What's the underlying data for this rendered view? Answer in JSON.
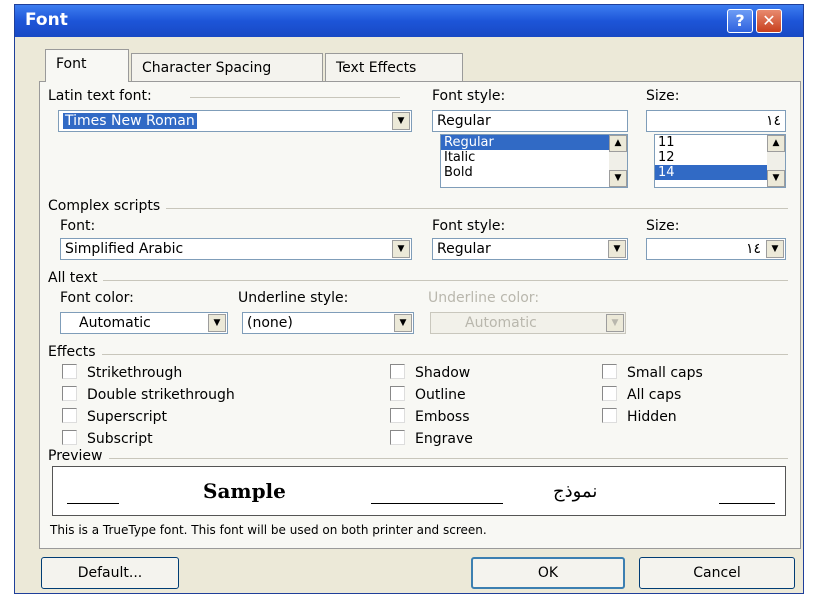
{
  "window": {
    "title": "Font",
    "help_glyph": "?",
    "close_glyph": "✕"
  },
  "tabs": [
    "Font",
    "Character Spacing",
    "Text Effects"
  ],
  "latin": {
    "font_label": "Latin text font:",
    "font_value": "Times New Roman",
    "style_label": "Font style:",
    "style_value": "Regular",
    "style_list": [
      "Regular",
      "Italic",
      "Bold"
    ],
    "size_label": "Size:",
    "size_value": "١٤",
    "size_list": [
      "11",
      "12",
      "14"
    ]
  },
  "complex": {
    "group_label": "Complex scripts",
    "font_label": "Font:",
    "font_value": "Simplified Arabic",
    "style_label": "Font style:",
    "style_value": "Regular",
    "size_label": "Size:",
    "size_value": "١٤"
  },
  "all_text": {
    "group_label": "All text",
    "color_label": "Font color:",
    "color_value": "Automatic",
    "underline_label": "Underline style:",
    "underline_value": "(none)",
    "underline_color_label": "Underline color:",
    "underline_color_value": "Automatic"
  },
  "effects": {
    "group_label": "Effects",
    "col1": [
      "Strikethrough",
      "Double strikethrough",
      "Superscript",
      "Subscript"
    ],
    "col2": [
      "Shadow",
      "Outline",
      "Emboss",
      "Engrave"
    ],
    "col3": [
      "Small caps",
      "All caps",
      "Hidden"
    ]
  },
  "preview": {
    "group_label": "Preview",
    "sample_text": "Sample",
    "arabic_text": "نموذج",
    "note": "This is a TrueType font. This font will be used on both printer and screen."
  },
  "buttons": {
    "default": "Default...",
    "ok": "OK",
    "cancel": "Cancel"
  },
  "colors": {
    "title_bar": "#1d55d8",
    "selection": "#316ac5",
    "dialog_bg": "#ece9d8"
  }
}
